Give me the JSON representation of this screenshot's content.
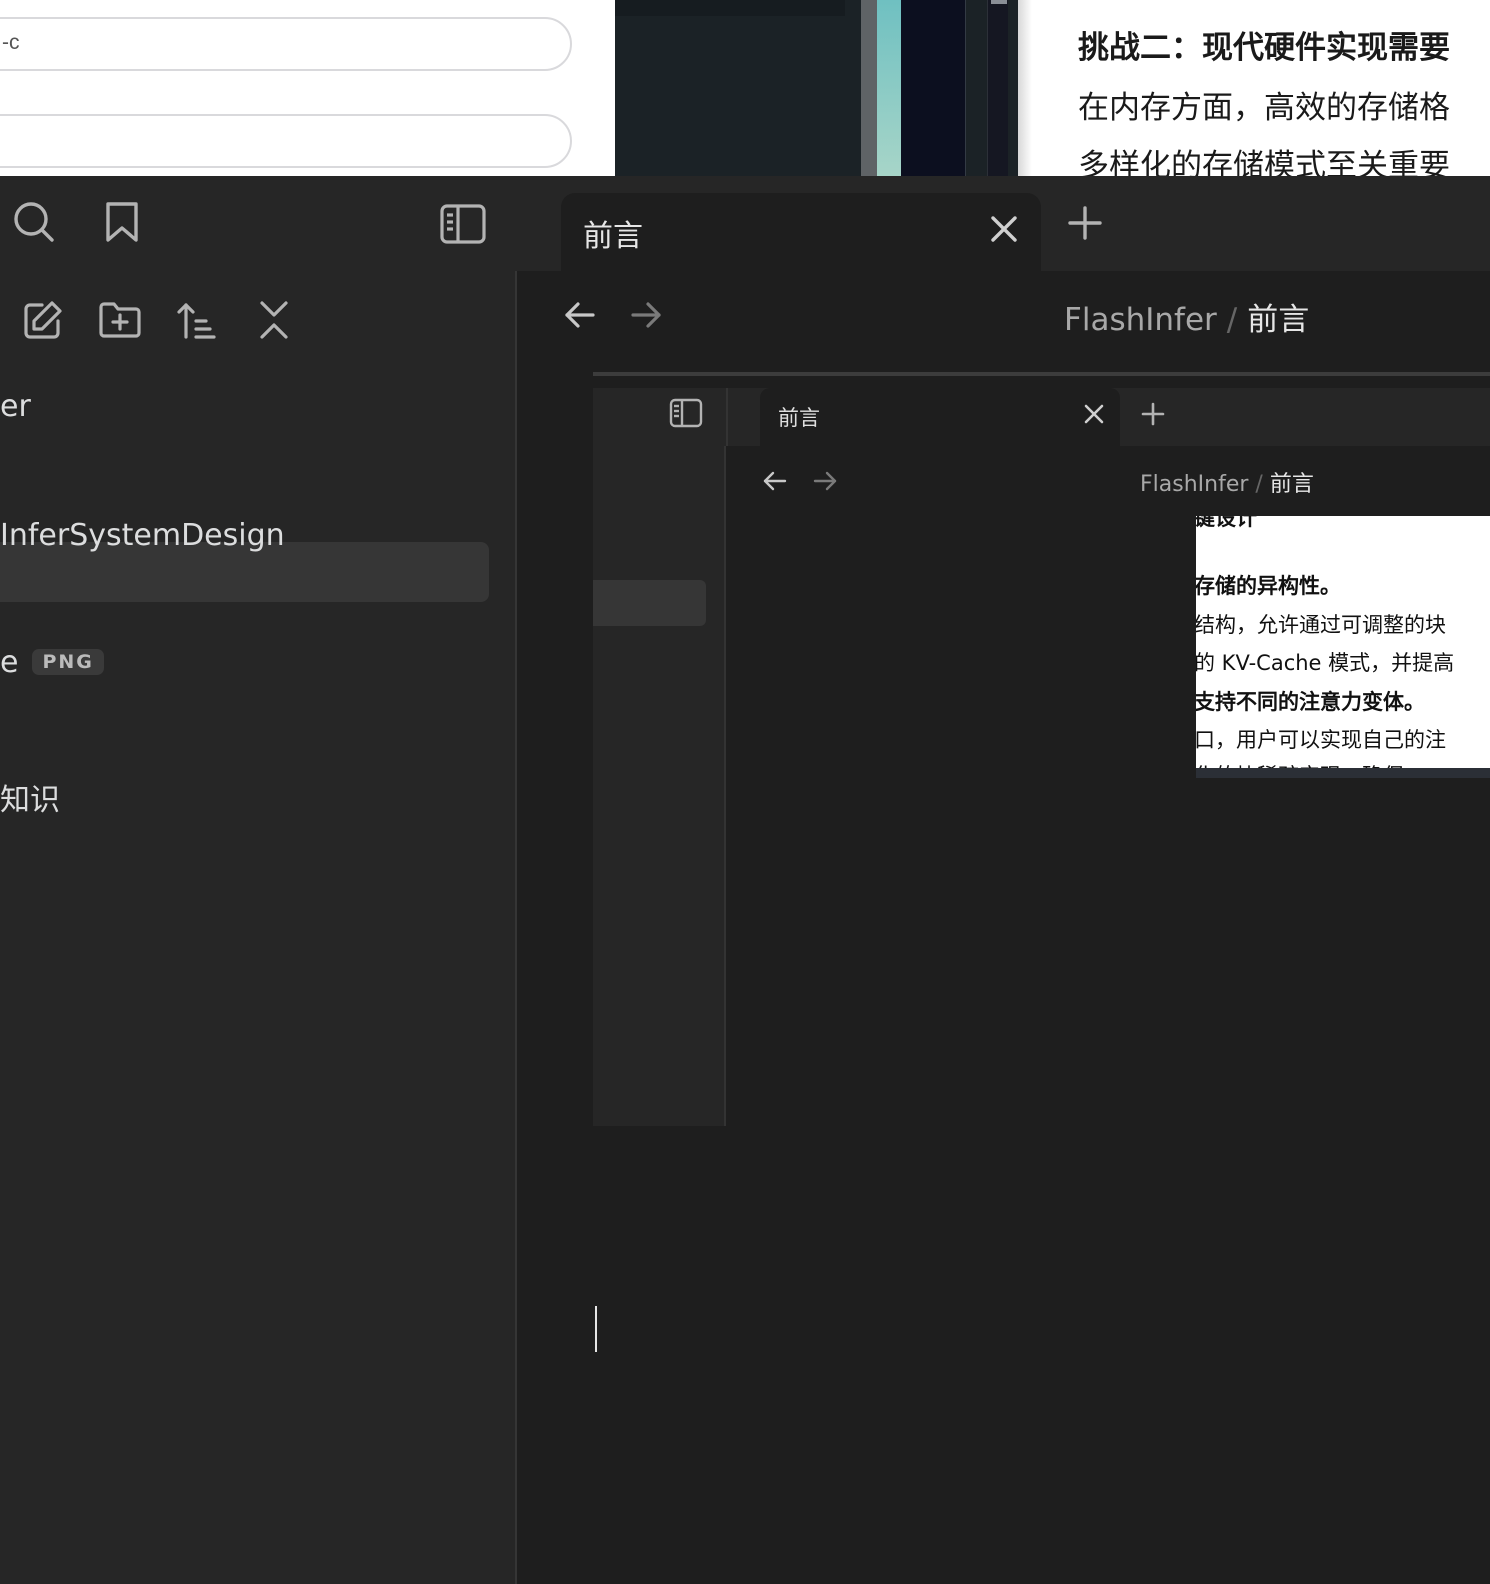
{
  "background_windows": {
    "browser": {
      "field1_value": "-c",
      "field2_value": ""
    },
    "document": {
      "lines": [
        "挑战二：现代硬件实现需要",
        "在内存方面，高效的存储格",
        "多样化的存储模式至关重要"
      ]
    }
  },
  "obsidian": {
    "tabs": [
      {
        "title": "前言",
        "active": true
      }
    ],
    "breadcrumb": {
      "root": "FlashInfer",
      "separator": "/",
      "current": "前言"
    },
    "file_tree": {
      "items": [
        {
          "label": "er"
        },
        {
          "label": ""
        },
        {
          "label": "InferSystemDesign"
        },
        {
          "label": "e",
          "badge": "PNG"
        },
        {
          "label": "知识"
        }
      ]
    },
    "nested_screenshot": {
      "tab_title": "前言",
      "breadcrumb": {
        "root": "FlashInfer",
        "separator": "/",
        "current": "前言"
      },
      "image_text": {
        "lines": [
          "键设计",
          "存储的异构性。",
          "结构，允许通过可调整的块",
          "的 KV-Cache 模式，并提高",
          "支持不同的注意力变体。",
          "口，用户可以实现自己的注",
          "化的块稀疏实现，确保"
        ]
      }
    }
  }
}
